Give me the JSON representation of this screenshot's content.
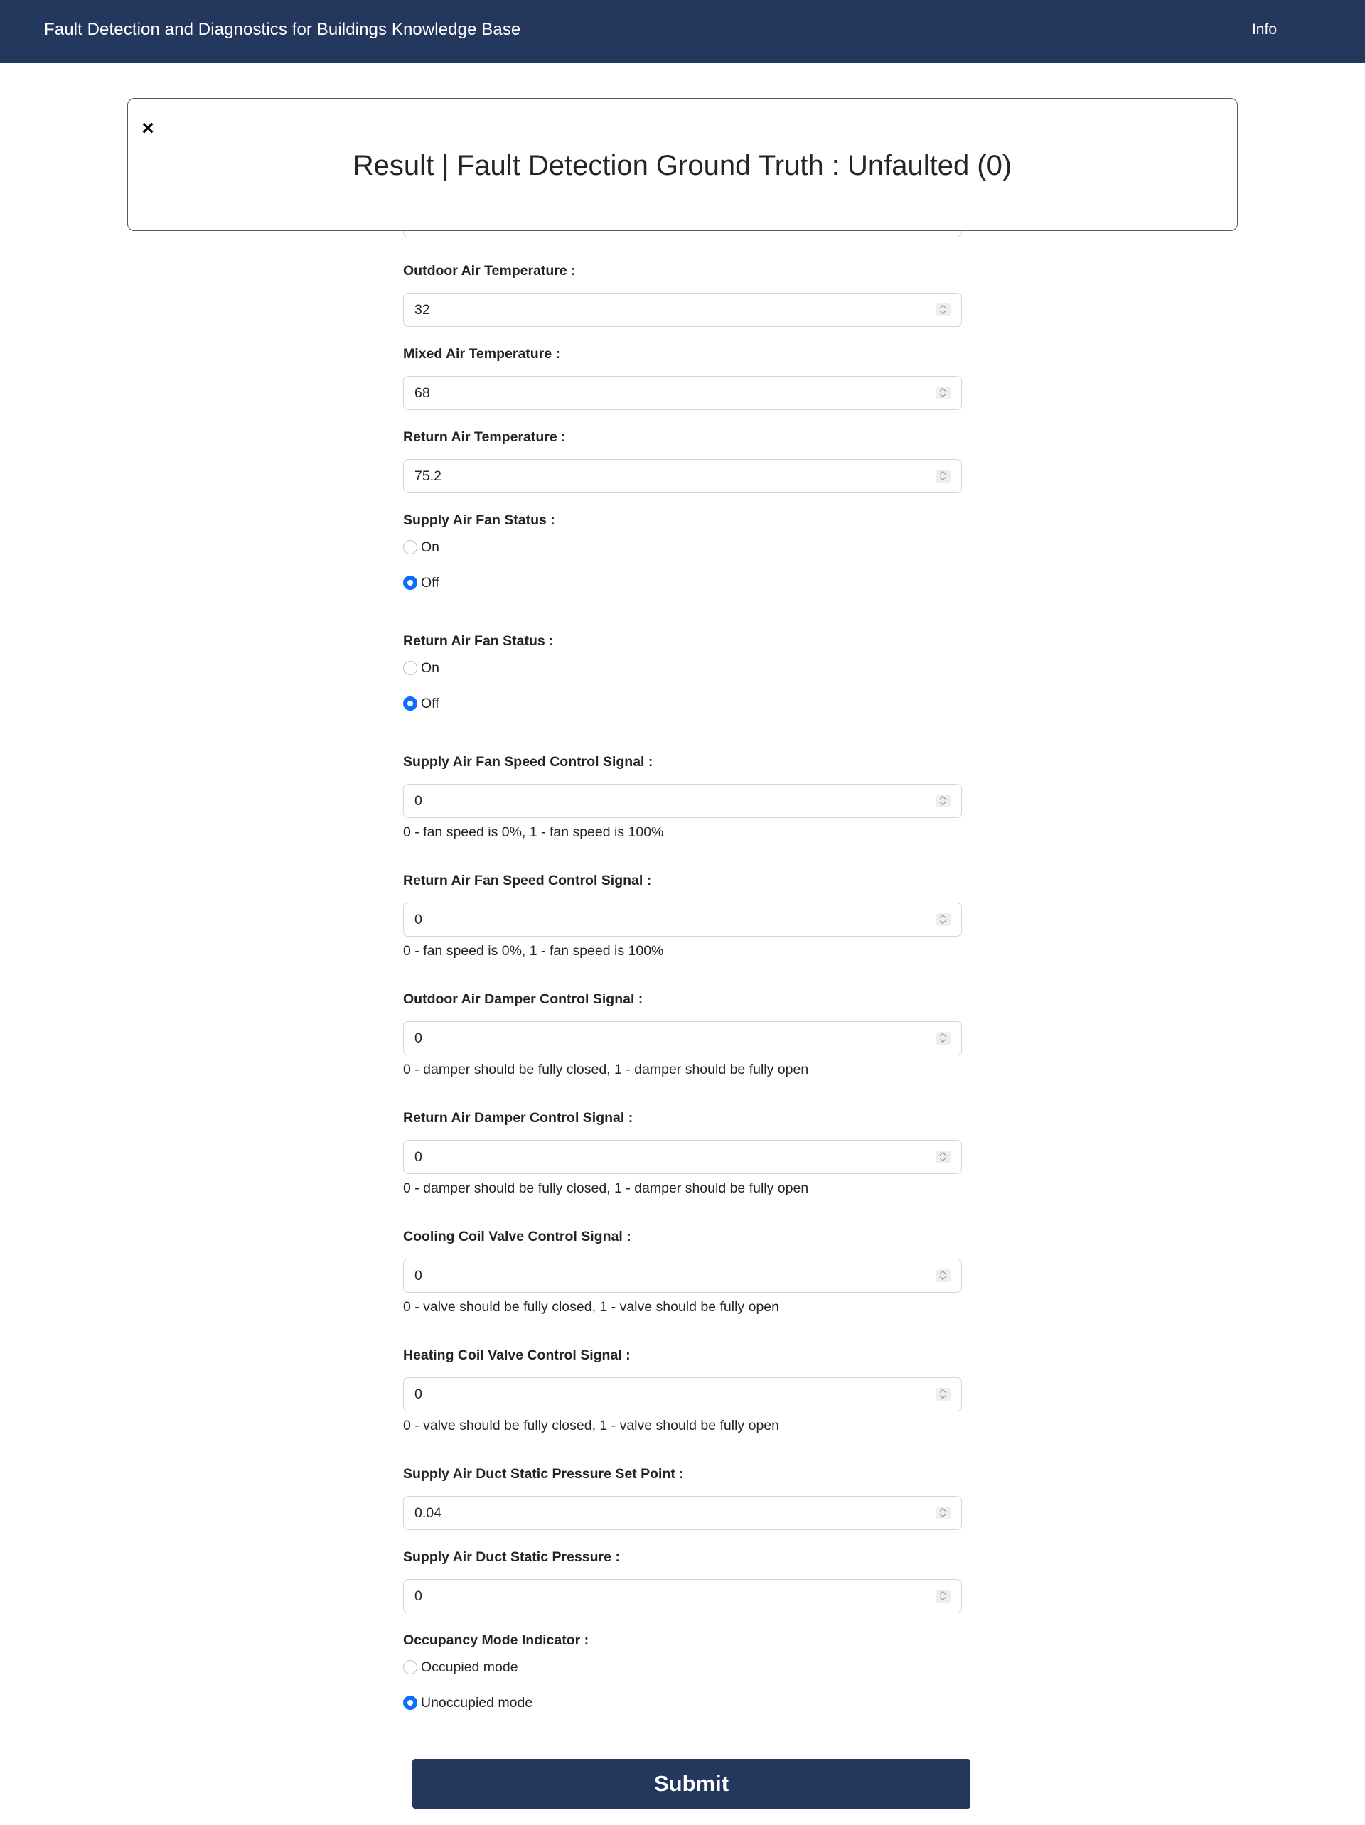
{
  "navbar": {
    "brand": "Fault Detection and Diagnostics for Buildings Knowledge Base",
    "info_link": "Info"
  },
  "modal": {
    "close_icon": "×",
    "title": "Result | Fault Detection Ground Truth : Unfaulted (0)"
  },
  "form": {
    "outdoor_air_temp": {
      "label": "Outdoor Air Temperature :",
      "value": "32"
    },
    "mixed_air_temp": {
      "label": "Mixed Air Temperature :",
      "value": "68"
    },
    "return_air_temp": {
      "label": "Return Air Temperature :",
      "value": "75.2"
    },
    "supply_fan_status": {
      "label": "Supply Air Fan Status :",
      "options": [
        {
          "label": "On",
          "checked": false
        },
        {
          "label": "Off",
          "checked": true
        }
      ]
    },
    "return_fan_status": {
      "label": "Return Air Fan Status :",
      "options": [
        {
          "label": "On",
          "checked": false
        },
        {
          "label": "Off",
          "checked": true
        }
      ]
    },
    "supply_fan_speed": {
      "label": "Supply Air Fan Speed Control Signal :",
      "value": "0",
      "help": "0 - fan speed is 0%, 1 - fan speed is 100%"
    },
    "return_fan_speed": {
      "label": "Return Air Fan Speed Control Signal :",
      "value": "0",
      "help": "0 - fan speed is 0%, 1 - fan speed is 100%"
    },
    "outdoor_damper": {
      "label": "Outdoor Air Damper Control Signal :",
      "value": "0",
      "help": "0 - damper should be fully closed, 1 - damper should be fully open"
    },
    "return_damper": {
      "label": "Return Air Damper Control Signal :",
      "value": "0",
      "help": "0 - damper should be fully closed, 1 - damper should be fully open"
    },
    "cooling_valve": {
      "label": "Cooling Coil Valve Control Signal :",
      "value": "0",
      "help": "0 - valve should be fully closed, 1 - valve should be fully open"
    },
    "heating_valve": {
      "label": "Heating Coil Valve Control Signal :",
      "value": "0",
      "help": "0 - valve should be fully closed, 1 - valve should be fully open"
    },
    "static_pressure_setpoint": {
      "label": "Supply Air Duct Static Pressure Set Point :",
      "value": "0.04"
    },
    "static_pressure": {
      "label": "Supply Air Duct Static Pressure :",
      "value": "0"
    },
    "occupancy_mode": {
      "label": "Occupancy Mode Indicator :",
      "options": [
        {
          "label": "Occupied mode",
          "checked": false
        },
        {
          "label": "Unoccupied mode",
          "checked": true
        }
      ]
    },
    "submit_label": "Submit"
  },
  "colors": {
    "navbar_bg": "#24375c",
    "radio_checked": "#0d6efd",
    "submit_bg": "#24375c"
  }
}
